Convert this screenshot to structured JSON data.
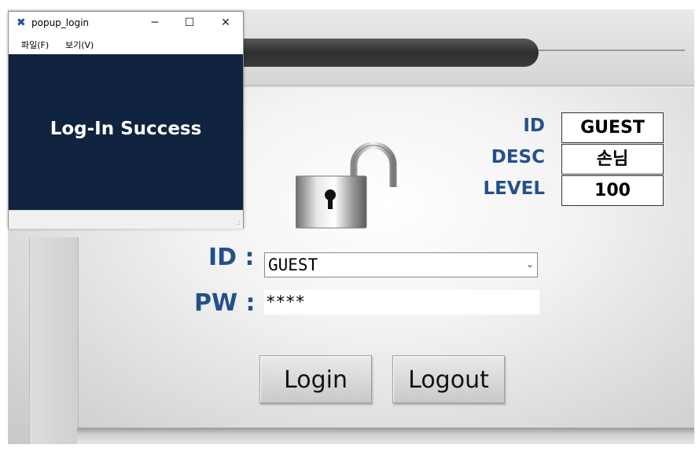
{
  "popup": {
    "title": "popup_login",
    "menu": [
      "파일(F)",
      "보기(V)"
    ],
    "message": "Log-In Success",
    "controls": {
      "minimize": "─",
      "maximize": "☐",
      "close": "✕"
    }
  },
  "info": {
    "labels": {
      "id": "ID",
      "desc": "DESC",
      "level": "LEVEL"
    },
    "values": {
      "id": "GUEST",
      "desc": "손님",
      "level": "100"
    }
  },
  "form": {
    "id_label": "ID :",
    "pw_label": "PW :",
    "id_value": "GUEST",
    "pw_value": "****"
  },
  "buttons": {
    "login": "Login",
    "logout": "Logout"
  },
  "colors": {
    "label": "#24508a",
    "popup_body": "#10233f",
    "popup_icon": "#1c4fa8"
  }
}
